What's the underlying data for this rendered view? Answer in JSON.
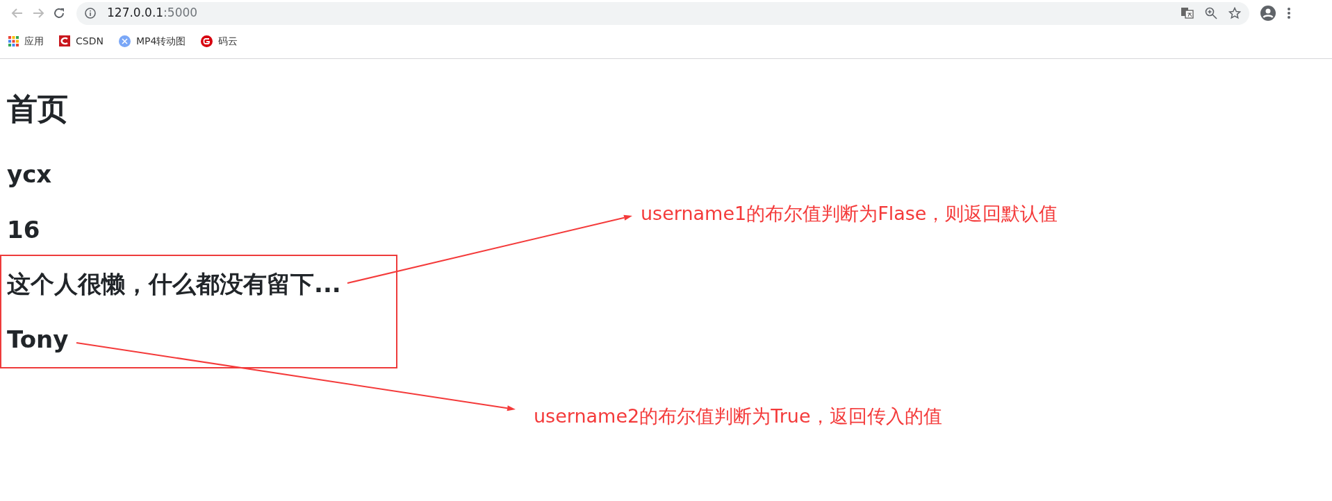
{
  "browser": {
    "url_host": "127.0.0.1",
    "url_port": ":5000",
    "bookmarks": [
      {
        "kind": "apps",
        "label": "应用"
      },
      {
        "kind": "csdn",
        "label": "CSDN"
      },
      {
        "kind": "mp4",
        "label": "MP4转动图"
      },
      {
        "kind": "gitee",
        "label": "码云"
      }
    ]
  },
  "page": {
    "headings": [
      {
        "kind": "title",
        "text": "首页"
      },
      {
        "kind": "heading",
        "text": "ycx"
      },
      {
        "kind": "heading",
        "text": "16"
      }
    ],
    "highlighted_headings": [
      {
        "kind": "heading",
        "text": "这个人很懒，什么都没有留下..."
      },
      {
        "kind": "heading",
        "text": "Tony"
      }
    ]
  },
  "annotations": [
    {
      "text": "username1的布尔值判断为Flase，则返回默认值"
    },
    {
      "text": "username2的布尔值判断为True，返回传入的值"
    }
  ]
}
